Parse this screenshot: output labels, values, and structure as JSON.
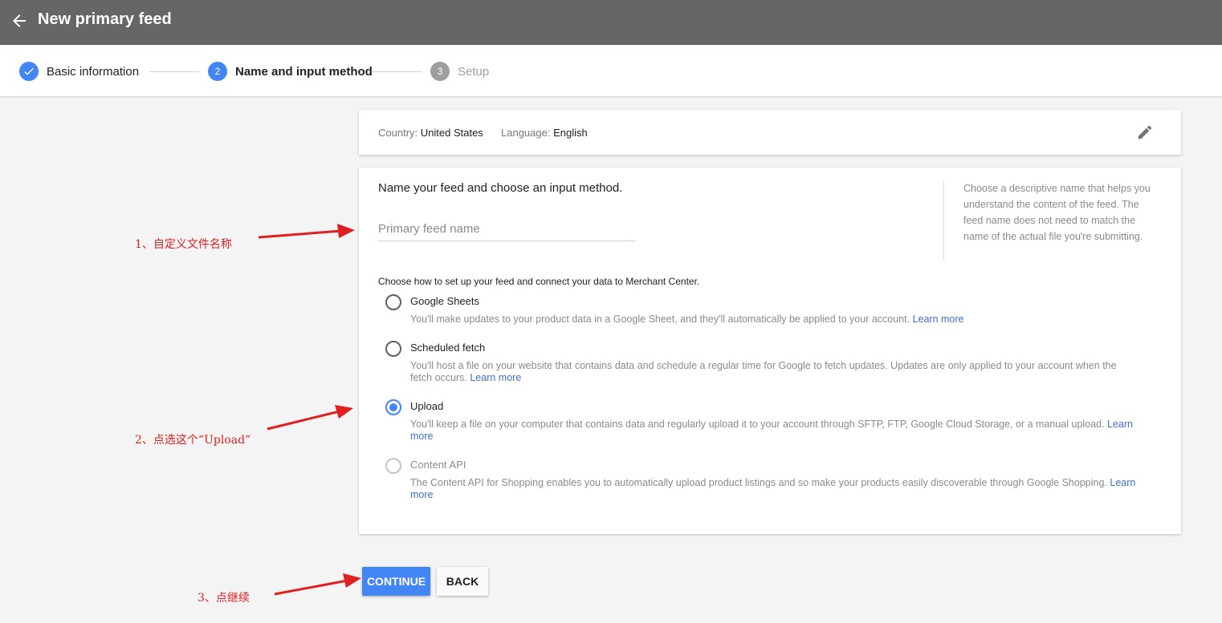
{
  "header": {
    "title": "New primary feed"
  },
  "stepper": {
    "steps": [
      {
        "label": "Basic information",
        "state": "done",
        "number": ""
      },
      {
        "label": "Name and input method",
        "state": "active",
        "number": "2"
      },
      {
        "label": "Setup",
        "state": "pending",
        "number": "3"
      }
    ]
  },
  "summary": {
    "country_label": "Country:",
    "country_value": "United States",
    "language_label": "Language:",
    "language_value": "English"
  },
  "form": {
    "heading": "Name your feed and choose an input method.",
    "name_placeholder": "Primary feed name",
    "name_value": "",
    "help_text": "Choose a descriptive name that helps you understand the content of the feed. The feed name does not need to match the name of the actual file you're submitting.",
    "choose_text": "Choose how to set up your feed and connect your data to Merchant Center.",
    "options": [
      {
        "title": "Google Sheets",
        "desc": "You'll make updates to your product data in a Google Sheet, and they'll automatically be applied to your account.",
        "link": "Learn more",
        "selected": false,
        "disabled": false
      },
      {
        "title": "Scheduled fetch",
        "desc": "You'll host a file on your website that contains data and schedule a regular time for Google to fetch updates. Updates are only applied to your account when the fetch occurs.",
        "link": "Learn more",
        "selected": false,
        "disabled": false
      },
      {
        "title": "Upload",
        "desc": "You'll keep a file on your computer that contains data and regularly upload it to your account through SFTP, FTP, Google Cloud Storage, or a manual upload.",
        "link": "Learn more",
        "selected": true,
        "disabled": false
      },
      {
        "title": "Content API",
        "desc": "The Content API for Shopping enables you to automatically upload product listings and so make your products easily discoverable through Google Shopping.",
        "link": "Learn more",
        "selected": false,
        "disabled": true
      }
    ]
  },
  "buttons": {
    "continue": "CONTINUE",
    "back": "BACK"
  },
  "annotations": {
    "a1": "1、自定义文件名称",
    "a2": "2、点选这个“Upload”",
    "a3": "3、点继续"
  },
  "colors": {
    "primary": "#4285f4",
    "topbar": "#666666",
    "annotation": "#e02020"
  }
}
